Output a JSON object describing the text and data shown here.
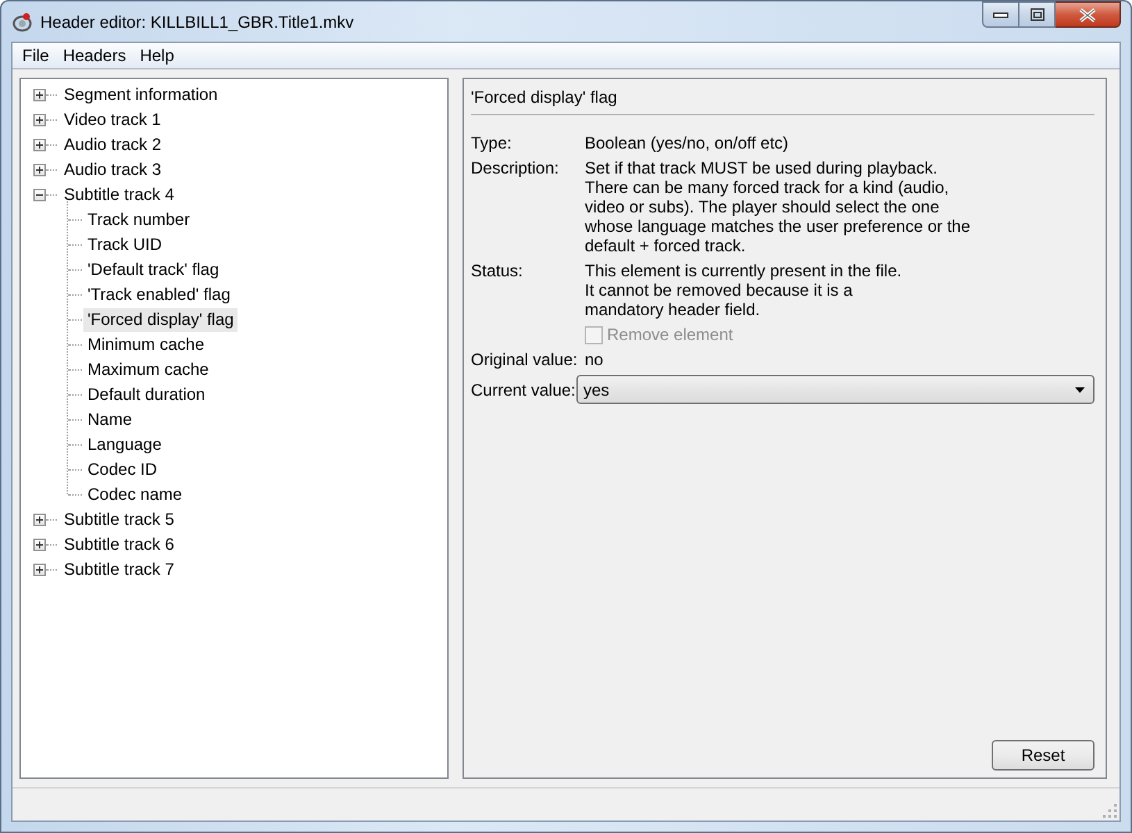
{
  "window": {
    "title": "Header editor: KILLBILL1_GBR.Title1.mkv"
  },
  "menu": [
    "File",
    "Headers",
    "Help"
  ],
  "tree": [
    {
      "label": "Segment information",
      "expanded": false,
      "selected": false
    },
    {
      "label": "Video track 1",
      "expanded": false,
      "selected": false
    },
    {
      "label": "Audio track 2",
      "expanded": false,
      "selected": false
    },
    {
      "label": "Audio track 3",
      "expanded": false,
      "selected": false
    },
    {
      "label": "Subtitle track 4",
      "expanded": true,
      "selected": false,
      "children": [
        {
          "label": "Track number",
          "selected": false
        },
        {
          "label": "Track UID",
          "selected": false
        },
        {
          "label": "'Default track' flag",
          "selected": false
        },
        {
          "label": "'Track enabled' flag",
          "selected": false
        },
        {
          "label": "'Forced display' flag",
          "selected": true
        },
        {
          "label": "Minimum cache",
          "selected": false
        },
        {
          "label": "Maximum cache",
          "selected": false
        },
        {
          "label": "Default duration",
          "selected": false
        },
        {
          "label": "Name",
          "selected": false
        },
        {
          "label": "Language",
          "selected": false
        },
        {
          "label": "Codec ID",
          "selected": false
        },
        {
          "label": "Codec name",
          "selected": false
        }
      ]
    },
    {
      "label": "Subtitle track 5",
      "expanded": false,
      "selected": false
    },
    {
      "label": "Subtitle track 6",
      "expanded": false,
      "selected": false
    },
    {
      "label": "Subtitle track 7",
      "expanded": false,
      "selected": false
    }
  ],
  "detail": {
    "heading": "'Forced display' flag",
    "fields": [
      {
        "label": "Type:",
        "value": "Boolean (yes/no, on/off etc)"
      },
      {
        "label": "Description:",
        "value": "Set if that track MUST be used during playback.\nThere can be many forced track for a kind (audio,\nvideo or subs). The player should select the one\nwhose language matches the user preference or the\ndefault + forced track."
      },
      {
        "label": "Status:",
        "value": "This element is currently present in the file.\nIt cannot be removed because it is a\nmandatory header field."
      }
    ],
    "remove_element": {
      "label": "Remove element",
      "checked": false,
      "disabled": true
    },
    "original_value": {
      "label": "Original value:",
      "value": "no"
    },
    "current_value": {
      "label": "Current value:",
      "value": "yes"
    },
    "reset_button": "Reset"
  }
}
